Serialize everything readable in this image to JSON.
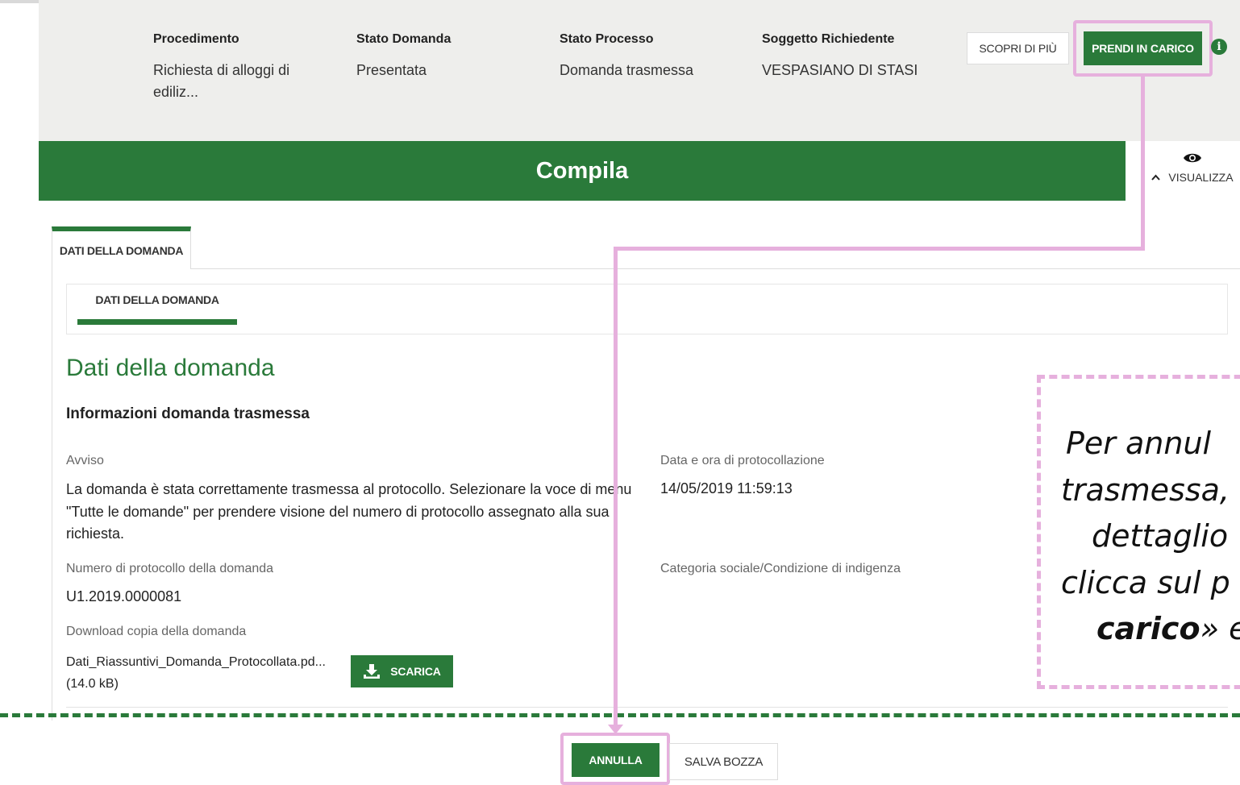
{
  "summary": {
    "procedimento_label": "Procedimento",
    "procedimento_value": "Richiesta di alloggi di ediliz...",
    "stato_domanda_label": "Stato Domanda",
    "stato_domanda_value": "Presentata",
    "stato_processo_label": "Stato Processo",
    "stato_processo_value": "Domanda trasmessa",
    "soggetto_label": "Soggetto Richiedente",
    "soggetto_value": "VESPASIANO DI STASI",
    "scopri_label": "SCOPRI DI PIÙ",
    "prendi_label": "PRENDI IN CARICO",
    "info_icon": "i"
  },
  "title_bar": {
    "title": "Compila",
    "visualizza_label": "VISUALIZZA",
    "eye_icon": "eye-icon",
    "chevron_icon": "chevron-up-icon"
  },
  "tabs": {
    "outer_tab": "DATI DELLA DOMANDA",
    "inner_tab": "DATI DELLA DOMANDA"
  },
  "section": {
    "title": "Dati della domanda",
    "subtitle": "Informazioni domanda trasmessa",
    "avviso_label": "Avviso",
    "avviso_text": "La domanda è stata correttamente trasmessa al protocollo. Selezionare la voce di menu \"Tutte le domande\" per prendere visione del numero di protocollo assegnato alla sua richiesta.",
    "data_label": "Data e ora di protocollazione",
    "data_value": "14/05/2019 11:59:13",
    "numero_label": "Numero di protocollo della domanda",
    "numero_value": "U1.2019.0000081",
    "categoria_label": "Categoria sociale/Condizione di indigenza",
    "download_label": "Download copia della domanda",
    "file_name": "Dati_Riassuntivi_Domanda_Protocollata.pd...",
    "file_size": "(14.0 kB)",
    "scarica_label": "SCARICA"
  },
  "callout": {
    "line1": "Per annul",
    "line2": "trasmessa,",
    "line3": "dettaglio",
    "line4": "clicca sul p",
    "line5_bold": "carico",
    "line5_rest": "» e"
  },
  "footer": {
    "annulla_label": "ANNULLA",
    "salva_label": "SALVA BOZZA"
  },
  "colors": {
    "brand_green": "#2a7a3a",
    "highlight_pink": "#e6b0dd",
    "summary_bg": "#eeeeec"
  }
}
